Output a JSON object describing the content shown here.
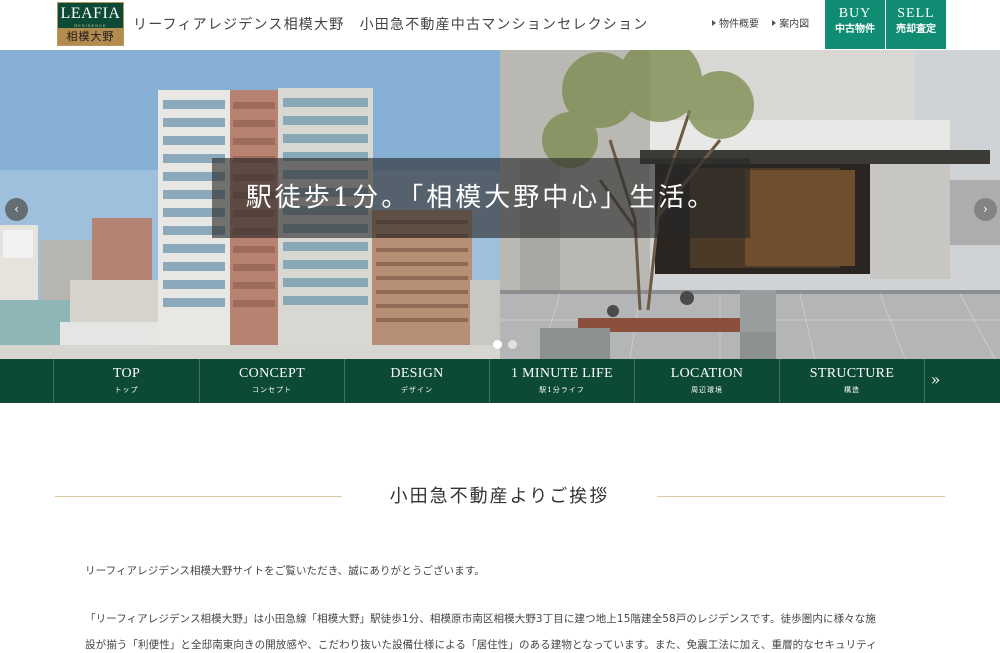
{
  "header": {
    "logo": {
      "main": "LEAFIA",
      "sub": "RESIDENCE",
      "band": "相模大野"
    },
    "site_title": "リーフィアレジデンス相模大野　小田急不動産中古マンションセレクション",
    "links": [
      "物件概要",
      "案内図"
    ],
    "buy": {
      "en": "BUY",
      "ja": "中古物件"
    },
    "sell": {
      "en": "SELL",
      "ja": "売却査定"
    }
  },
  "hero": {
    "caption": "駅徒歩1分。「相模大野中心」生活。",
    "prev_icon": "‹",
    "next_icon": "›",
    "slides": 2,
    "active_slide": 1
  },
  "nav": {
    "items": [
      {
        "en": "TOP",
        "ja": "トップ"
      },
      {
        "en": "CONCEPT",
        "ja": "コンセプト"
      },
      {
        "en": "DESIGN",
        "ja": "デザイン"
      },
      {
        "en": "1 MINUTE LIFE",
        "ja": "駅1分ライフ"
      },
      {
        "en": "LOCATION",
        "ja": "周辺環境"
      },
      {
        "en": "STRUCTURE",
        "ja": "構造"
      }
    ],
    "more": "»"
  },
  "main": {
    "title": "小田急不動産よりご挨拶",
    "paragraphs": [
      "リーフィアレジデンス相模大野サイトをご覧いただき、誠にありがとうございます。",
      "「リーフィアレジデンス相模大野」は小田急線「相模大野」駅徒歩1分、相模原市南区相模大野3丁目に建つ地上15階建全58戸のレジデンスです。徒歩圏内に様々な施",
      "設が揃う「利便性」と全邸南東向きの開放感や、こだわり抜いた設備仕様による「居住性」のある建物となっています。また、免震工法に加え、重層的なセキュリティ"
    ]
  },
  "colors": {
    "brand_green": "#0c4a35",
    "button_teal": "#0f8c72",
    "gold": "#b48b4e"
  }
}
